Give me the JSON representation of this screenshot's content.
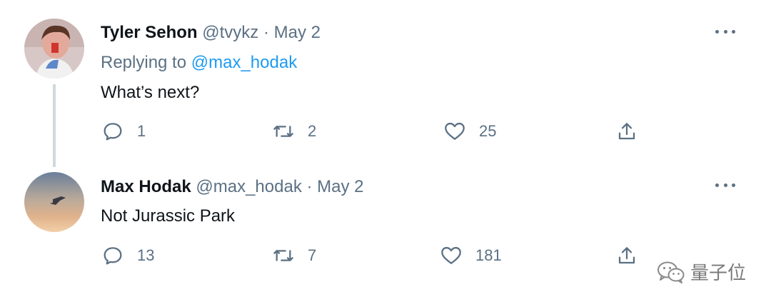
{
  "tweets": [
    {
      "name": "Tyler Sehon",
      "handle": "@tvykz",
      "separator": "·",
      "date": "May 2",
      "replying_label": "Replying to",
      "replying_mention": "@max_hodak",
      "text": "What’s next?",
      "replies": "1",
      "retweets": "2",
      "likes": "25"
    },
    {
      "name": "Max Hodak",
      "handle": "@max_hodak",
      "separator": "·",
      "date": "May 2",
      "text": "Not Jurassic Park",
      "replies": "13",
      "retweets": "7",
      "likes": "181"
    }
  ],
  "watermark": {
    "text": "量子位",
    "icon": "wechat-logo-icon"
  },
  "colors": {
    "muted": "#5b7083",
    "link": "#1d9bf0",
    "thread": "#cfd9de",
    "text": "#0f1419"
  }
}
